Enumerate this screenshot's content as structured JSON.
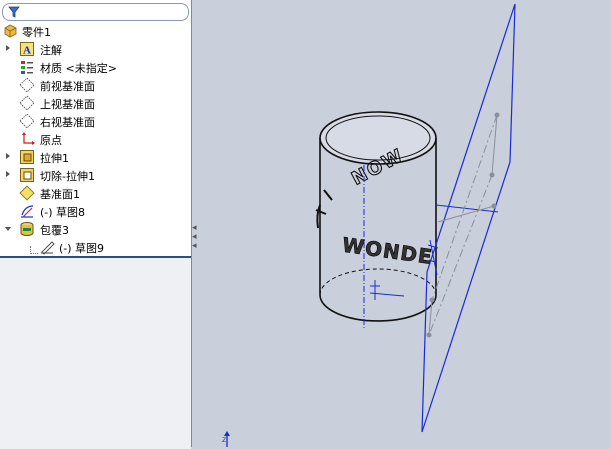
{
  "filter": {
    "icon": "filter-funnel-icon"
  },
  "tree": {
    "root": {
      "label": "零件1",
      "icon": "part-icon"
    },
    "items": [
      {
        "label": "注解",
        "icon": "annotations-icon"
      },
      {
        "label": "材质 <未指定>",
        "icon": "material-icon"
      },
      {
        "label": "前视基准面",
        "icon": "plane-icon"
      },
      {
        "label": "上视基准面",
        "icon": "plane-icon"
      },
      {
        "label": "右视基准面",
        "icon": "plane-icon"
      },
      {
        "label": "原点",
        "icon": "origin-icon"
      },
      {
        "label": "拉伸1",
        "icon": "extrude-icon"
      },
      {
        "label": "切除-拉伸1",
        "icon": "cut-extrude-icon"
      },
      {
        "label": "基准面1",
        "icon": "plane-yellow-icon"
      },
      {
        "label": "(-) 草图8",
        "icon": "sketch-icon"
      },
      {
        "label": "包覆3",
        "icon": "wrap-icon"
      },
      {
        "label": "(-) 草图9",
        "icon": "sketch-icon"
      }
    ]
  },
  "viewport": {
    "engraved_text_front": "WONDE",
    "engraved_text_top": "NOW",
    "background_color": "#c9cfdb",
    "sketch_color": "#1a2bd6"
  }
}
